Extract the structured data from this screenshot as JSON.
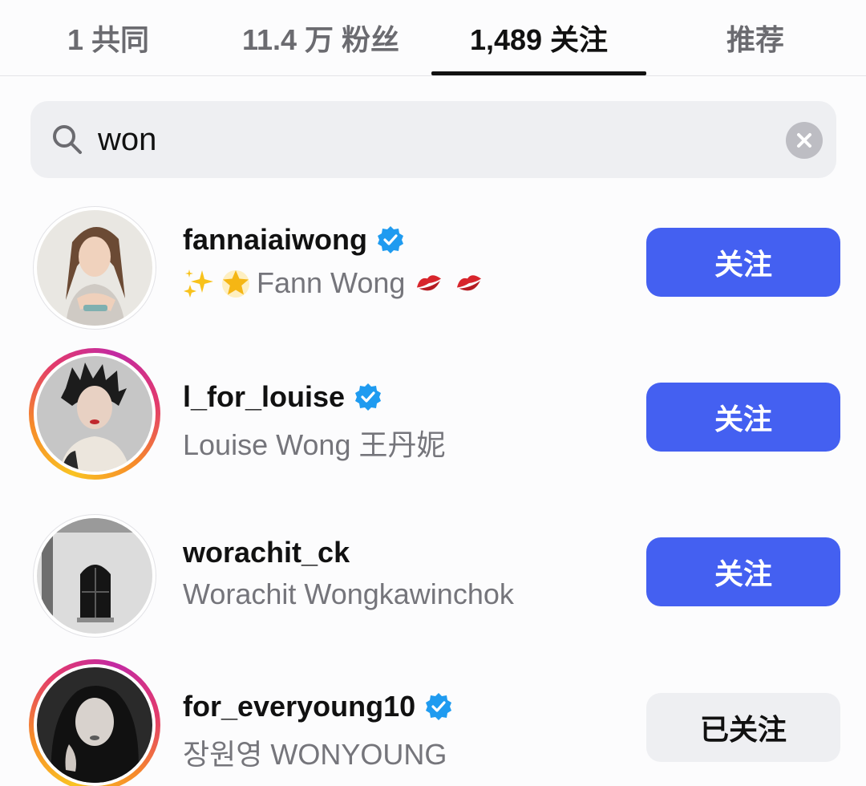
{
  "tabs": [
    {
      "label": "1 共同"
    },
    {
      "label": "11.4 万 粉丝"
    },
    {
      "label": "1,489 关注"
    },
    {
      "label": "推荐"
    }
  ],
  "search": {
    "value": "won",
    "placeholder": ""
  },
  "users": [
    {
      "username": "fannaiaiwong",
      "verified": true,
      "fullname": "Fann Wong",
      "fullname_emojis": [
        "sparkles-icon",
        "star-icon",
        "kiss-icon",
        "kiss-icon"
      ],
      "button_label": "关注",
      "story_ring": false
    },
    {
      "username": "l_for_louise",
      "verified": true,
      "fullname": "Louise Wong 王丹妮",
      "button_label": "关注",
      "story_ring": true
    },
    {
      "username": "worachit_ck",
      "verified": false,
      "fullname": "Worachit Wongkawinchok",
      "button_label": "关注",
      "story_ring": false
    },
    {
      "username": "for_everyoung10",
      "verified": true,
      "fullname": "장원영 WONYOUNG",
      "button_label": "已关注",
      "story_ring": true
    }
  ],
  "colors": {
    "accent": "#4460f1",
    "verified": "#1f9bf0",
    "secondary_text": "#75757b",
    "search_bg": "#eeeff2"
  }
}
